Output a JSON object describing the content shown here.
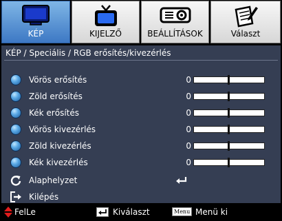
{
  "tabs": [
    {
      "label": "KÉP",
      "icon": "monitor-icon",
      "active": true
    },
    {
      "label": "KIJELZŐ",
      "icon": "tv-icon",
      "active": false
    },
    {
      "label": "BEÁLLÍTÁSOK",
      "icon": "projector-icon",
      "active": false
    },
    {
      "label": "Választ",
      "icon": "notepad-pencil-icon",
      "active": false
    }
  ],
  "breadcrumb": "KÉP / Speciális / RGB erősítés/kivezérlés",
  "settings": [
    {
      "label": "Vörös erősítés",
      "value": "0",
      "level": 0.5
    },
    {
      "label": "Zöld erősítés",
      "value": "0",
      "level": 0.5
    },
    {
      "label": "Kék erősítés",
      "value": "0",
      "level": 0.5
    },
    {
      "label": "Vörös kivezérlés",
      "value": "0",
      "level": 0.5
    },
    {
      "label": "Zöld kivezérlés",
      "value": "0",
      "level": 0.5
    },
    {
      "label": "Kék kivezérlés",
      "value": "0",
      "level": 0.5
    }
  ],
  "reset": {
    "label": "Alaphelyzet",
    "icon": "reset-icon",
    "action_icon": "enter-icon"
  },
  "exit": {
    "label": "Kilépés",
    "icon": "exit-icon"
  },
  "footer": {
    "updown": {
      "label": "FelLe",
      "icon": "up-down-arrow-icon"
    },
    "select": {
      "label": "Kiválaszt",
      "icon": "enter-icon"
    },
    "menu": {
      "key": "Menu",
      "label": "Menü ki"
    }
  },
  "colors": {
    "panel": "#353e53",
    "active_tab": "#5a96d6",
    "inactive_tab": "#e6e6e6",
    "accent_arrow": "#e11c1c"
  }
}
